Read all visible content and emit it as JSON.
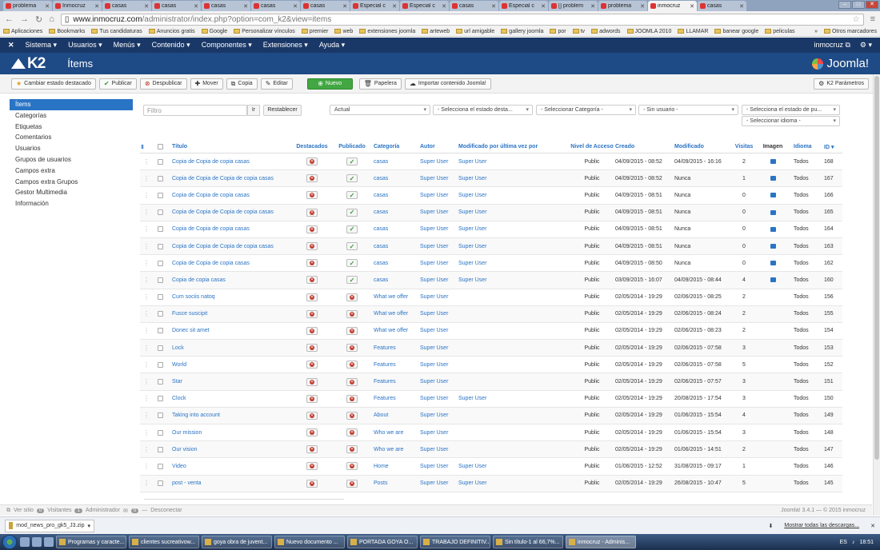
{
  "browser": {
    "tabs": [
      "problema",
      "Inmocruz",
      "casas",
      "casas",
      "casas",
      "casas",
      "casas",
      "Especial c",
      "Especial c",
      "casas",
      "Especial c",
      "[] problem",
      "problema",
      "inmocruz",
      "casas"
    ],
    "active_tab": 13,
    "url_host": "www.inmocruz.com",
    "url_path": "/administrator/index.php?option=com_k2&view=items",
    "bookmarks": [
      "Aplicaciones",
      "Bookmarks",
      "Tus candidaturas",
      "Anuncios gratis",
      "Google",
      "Personalizar vínculos",
      "premier",
      "web",
      "extensiones joomla",
      "arteweb",
      "url amigable",
      "gallery joomla",
      "por",
      "tv",
      "adwords",
      "JOOMLA 2010",
      "LLAMAR",
      "banear google",
      "peliculas"
    ],
    "bookmarks_more": "»",
    "other_bookmarks": "Otros marcadores"
  },
  "nav": {
    "menus": [
      "Sistema ▾",
      "Usuarios ▾",
      "Menús ▾",
      "Contenido ▾",
      "Componentes ▾",
      "Extensiones ▾",
      "Ayuda ▾"
    ],
    "site_name": "inmocruz ⧉",
    "settings": "⚙ ▾"
  },
  "header": {
    "logo": "K2",
    "title": "Ítems",
    "brand": "Joomla!"
  },
  "toolbar": {
    "buttons": [
      "Cambiar estado destacado",
      "Publicar",
      "Despublicar",
      "Mover",
      "Copia",
      "Editar",
      "Nuevo",
      "Papelera",
      "Importar contenido Joomla!"
    ],
    "icons": [
      "★",
      "✔",
      "⊗",
      "✚",
      "⧉",
      "✎",
      "⊕",
      "🗑",
      "☁"
    ],
    "params": "K2 Parámetros"
  },
  "sidebar": [
    "Ítems",
    "Categorías",
    "Etiquetas",
    "Comentarios",
    "Usuarios",
    "Grupos de usuarios",
    "Campos extra",
    "Campos extra Grupos",
    "Gestor Multimedia",
    "Información"
  ],
  "filters": {
    "search_placeholder": "Filtro",
    "go": "Ir",
    "reset": "Restablecer",
    "selects": [
      "Actual",
      "- Selecciona el estado desta...",
      "- Seleccionar Categoría -",
      "- Sin usuario -",
      "- Selecciona el estado de pu...",
      "- Seleccionar idioma -"
    ]
  },
  "table": {
    "headers": [
      "Título",
      "Destacados",
      "Publicado",
      "Categoría",
      "Autor",
      "Modificado por última vez por",
      "Nivel de Acceso",
      "Creado",
      "Modificado",
      "Visitas",
      "Imagen",
      "Idioma",
      "ID ▾"
    ],
    "rows": [
      {
        "title": "Copia de Copia de copia casas",
        "pub": true,
        "cat": "casas",
        "author": "Super User",
        "mod_by": "Super User",
        "access": "Public",
        "created": "04/09/2015 - 08:52",
        "modified": "04/09/2015 - 16:16",
        "hits": "2",
        "img": true,
        "lang": "Todos",
        "id": "168"
      },
      {
        "title": "Copia de Copia de Copia de copia casas",
        "pub": true,
        "cat": "casas",
        "author": "Super User",
        "mod_by": "Super User",
        "access": "Public",
        "created": "04/09/2015 - 08:52",
        "modified": "Nunca",
        "hits": "1",
        "img": true,
        "lang": "Todos",
        "id": "167"
      },
      {
        "title": "Copia de Copia de copia casas",
        "pub": true,
        "cat": "casas",
        "author": "Super User",
        "mod_by": "Super User",
        "access": "Public",
        "created": "04/09/2015 - 08:51",
        "modified": "Nunca",
        "hits": "0",
        "img": true,
        "lang": "Todos",
        "id": "166"
      },
      {
        "title": "Copia de Copia de Copia de copia casas",
        "pub": true,
        "cat": "casas",
        "author": "Super User",
        "mod_by": "Super User",
        "access": "Public",
        "created": "04/09/2015 - 08:51",
        "modified": "Nunca",
        "hits": "0",
        "img": true,
        "lang": "Todos",
        "id": "165"
      },
      {
        "title": "Copia de Copia de copia casas",
        "pub": true,
        "cat": "casas",
        "author": "Super User",
        "mod_by": "Super User",
        "access": "Public",
        "created": "04/09/2015 - 08:51",
        "modified": "Nunca",
        "hits": "0",
        "img": true,
        "lang": "Todos",
        "id": "164"
      },
      {
        "title": "Copia de Copia de Copia de copia casas",
        "pub": true,
        "cat": "casas",
        "author": "Super User",
        "mod_by": "Super User",
        "access": "Public",
        "created": "04/09/2015 - 08:51",
        "modified": "Nunca",
        "hits": "0",
        "img": true,
        "lang": "Todos",
        "id": "163"
      },
      {
        "title": "Copia de Copia de copia casas",
        "pub": true,
        "cat": "casas",
        "author": "Super User",
        "mod_by": "Super User",
        "access": "Public",
        "created": "04/09/2015 - 08:50",
        "modified": "Nunca",
        "hits": "0",
        "img": true,
        "lang": "Todos",
        "id": "162"
      },
      {
        "title": "Copia de copia casas",
        "pub": true,
        "cat": "casas",
        "author": "Super User",
        "mod_by": "Super User",
        "access": "Public",
        "created": "03/09/2015 - 16:07",
        "modified": "04/09/2015 - 08:44",
        "hits": "4",
        "img": true,
        "lang": "Todos",
        "id": "160"
      },
      {
        "title": "Cum sociis natoq",
        "pub": false,
        "cat": "What we offer",
        "author": "Super User",
        "mod_by": "",
        "access": "Public",
        "created": "02/05/2014 - 19:29",
        "modified": "02/06/2015 - 08:25",
        "hits": "2",
        "img": false,
        "lang": "Todos",
        "id": "156"
      },
      {
        "title": "Fusce suscipit",
        "pub": false,
        "cat": "What we offer",
        "author": "Super User",
        "mod_by": "",
        "access": "Public",
        "created": "02/05/2014 - 19:29",
        "modified": "02/06/2015 - 08:24",
        "hits": "2",
        "img": false,
        "lang": "Todos",
        "id": "155"
      },
      {
        "title": "Donec sit amet",
        "pub": false,
        "cat": "What we offer",
        "author": "Super User",
        "mod_by": "",
        "access": "Public",
        "created": "02/05/2014 - 19:29",
        "modified": "02/06/2015 - 08:23",
        "hits": "2",
        "img": false,
        "lang": "Todos",
        "id": "154"
      },
      {
        "title": "Lock",
        "pub": false,
        "cat": "Features",
        "author": "Super User",
        "mod_by": "",
        "access": "Public",
        "created": "02/05/2014 - 19:29",
        "modified": "02/06/2015 - 07:58",
        "hits": "3",
        "img": false,
        "lang": "Todos",
        "id": "153"
      },
      {
        "title": "World",
        "pub": false,
        "cat": "Features",
        "author": "Super User",
        "mod_by": "",
        "access": "Public",
        "created": "02/05/2014 - 19:29",
        "modified": "02/06/2015 - 07:58",
        "hits": "5",
        "img": false,
        "lang": "Todos",
        "id": "152"
      },
      {
        "title": "Star",
        "pub": false,
        "cat": "Features",
        "author": "Super User",
        "mod_by": "",
        "access": "Public",
        "created": "02/05/2014 - 19:29",
        "modified": "02/06/2015 - 07:57",
        "hits": "3",
        "img": false,
        "lang": "Todos",
        "id": "151"
      },
      {
        "title": "Clock",
        "pub": false,
        "cat": "Features",
        "author": "Super User",
        "mod_by": "Super User",
        "access": "Public",
        "created": "02/05/2014 - 19:29",
        "modified": "20/08/2015 - 17:54",
        "hits": "3",
        "img": false,
        "lang": "Todos",
        "id": "150"
      },
      {
        "title": "Taking into account",
        "pub": false,
        "cat": "About",
        "author": "Super User",
        "mod_by": "",
        "access": "Public",
        "created": "02/05/2014 - 19:29",
        "modified": "01/06/2015 - 15:54",
        "hits": "4",
        "img": false,
        "lang": "Todos",
        "id": "149"
      },
      {
        "title": "Our mission",
        "pub": false,
        "cat": "Who we are",
        "author": "Super User",
        "mod_by": "",
        "access": "Public",
        "created": "02/05/2014 - 19:29",
        "modified": "01/06/2015 - 15:54",
        "hits": "3",
        "img": false,
        "lang": "Todos",
        "id": "148"
      },
      {
        "title": "Our vision",
        "pub": false,
        "cat": "Who we are",
        "author": "Super User",
        "mod_by": "",
        "access": "Public",
        "created": "02/05/2014 - 19:29",
        "modified": "01/06/2015 - 14:51",
        "hits": "2",
        "img": false,
        "lang": "Todos",
        "id": "147"
      },
      {
        "title": "Video",
        "pub": false,
        "cat": "Home",
        "author": "Super User",
        "mod_by": "Super User",
        "access": "Public",
        "created": "01/06/2015 - 12:52",
        "modified": "31/08/2015 - 09:17",
        "hits": "1",
        "img": false,
        "lang": "Todos",
        "id": "146"
      },
      {
        "title": "post - venta",
        "pub": false,
        "cat": "Posts",
        "author": "Super User",
        "mod_by": "Super User",
        "access": "Public",
        "created": "02/05/2014 - 19:29",
        "modified": "26/08/2015 - 10:47",
        "hits": "5",
        "img": false,
        "lang": "Todos",
        "id": "145"
      }
    ]
  },
  "status": {
    "view_site": "Ver sitio",
    "visitors_count": "0",
    "visitors": "Visitantes",
    "admin_count": "1",
    "admin": "Administrador",
    "msg_count": "0",
    "logout": "Desconectar",
    "version": "Joomla! 3.4.1 — © 2015 inmocruz"
  },
  "downloads": {
    "file": "mod_news_pro_gk5_J3.zip",
    "show_all": "Mostrar todas las descargas...",
    "close": "✕"
  },
  "taskbar": {
    "items": [
      "Programas y caracte...",
      "clientes sucreativow...",
      "goya obra de juvent...",
      "Nuevo documento ...",
      "PORTADA GOYA O...",
      "TRABAJO DEFINITIV...",
      "Sin título-1 al 66,7%...",
      "inmocruz - Adminis..."
    ],
    "lang": "ES",
    "time": "18:51"
  }
}
